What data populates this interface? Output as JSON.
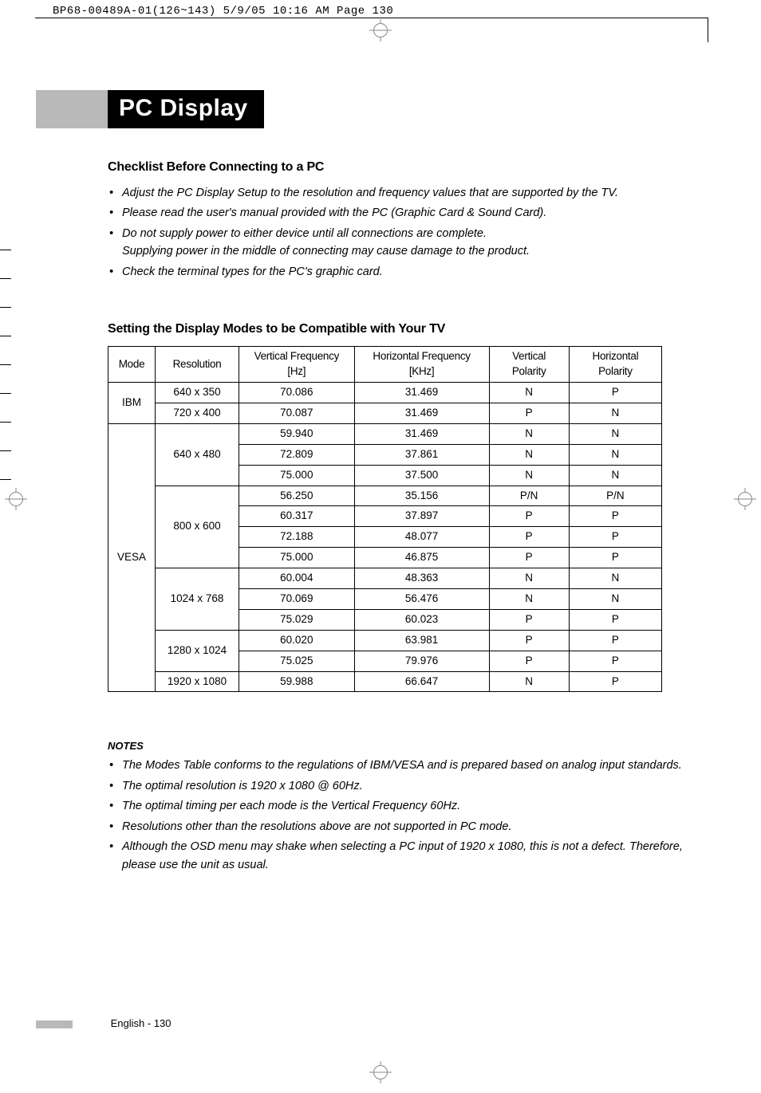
{
  "meta_line": "BP68-00489A-01(126~143)  5/9/05  10:16 AM  Page 130",
  "title": "PC Display",
  "checklist_heading": "Checklist Before Connecting to a PC",
  "checklist": [
    "Adjust the PC Display Setup to the resolution and frequency values that are supported by the TV.",
    "Please read the user's manual provided with the PC (Graphic Card & Sound Card).",
    "Do not supply power to either device until all connections are complete.\nSupplying power in the middle of connecting may cause damage to the product.",
    "Check the terminal types for the PC's graphic card."
  ],
  "modes_heading": "Setting the Display Modes to be Compatible with Your TV",
  "table": {
    "headers": [
      "Mode",
      "Resolution",
      "Vertical Frequency [Hz]",
      "Horizontal Frequency [KHz]",
      "Vertical Polarity",
      "Horizontal Polarity"
    ],
    "groups": [
      {
        "mode": "IBM",
        "res_groups": [
          {
            "res": "640 x 350",
            "rows": [
              [
                "70.086",
                "31.469",
                "N",
                "P"
              ]
            ]
          },
          {
            "res": "720 x 400",
            "rows": [
              [
                "70.087",
                "31.469",
                "P",
                "N"
              ]
            ]
          }
        ]
      },
      {
        "mode": "VESA",
        "res_groups": [
          {
            "res": "640 x 480",
            "rows": [
              [
                "59.940",
                "31.469",
                "N",
                "N"
              ],
              [
                "72.809",
                "37.861",
                "N",
                "N"
              ],
              [
                "75.000",
                "37.500",
                "N",
                "N"
              ]
            ]
          },
          {
            "res": "800 x 600",
            "rows": [
              [
                "56.250",
                "35.156",
                "P/N",
                "P/N"
              ],
              [
                "60.317",
                "37.897",
                "P",
                "P"
              ],
              [
                "72.188",
                "48.077",
                "P",
                "P"
              ],
              [
                "75.000",
                "46.875",
                "P",
                "P"
              ]
            ]
          },
          {
            "res": "1024 x 768",
            "rows": [
              [
                "60.004",
                "48.363",
                "N",
                "N"
              ],
              [
                "70.069",
                "56.476",
                "N",
                "N"
              ],
              [
                "75.029",
                "60.023",
                "P",
                "P"
              ]
            ]
          },
          {
            "res": "1280 x 1024",
            "rows": [
              [
                "60.020",
                "63.981",
                "P",
                "P"
              ],
              [
                "75.025",
                "79.976",
                "P",
                "P"
              ]
            ]
          },
          {
            "res": "1920 x 1080",
            "rows": [
              [
                "59.988",
                "66.647",
                "N",
                "P"
              ]
            ]
          }
        ]
      }
    ]
  },
  "chart_data": {
    "type": "table",
    "columns": [
      "Mode",
      "Resolution",
      "Vertical Frequency [Hz]",
      "Horizontal Frequency [KHz]",
      "Vertical Polarity",
      "Horizontal Polarity"
    ],
    "rows": [
      [
        "IBM",
        "640 x 350",
        "70.086",
        "31.469",
        "N",
        "P"
      ],
      [
        "IBM",
        "720 x 400",
        "70.087",
        "31.469",
        "P",
        "N"
      ],
      [
        "VESA",
        "640 x 480",
        "59.940",
        "31.469",
        "N",
        "N"
      ],
      [
        "VESA",
        "640 x 480",
        "72.809",
        "37.861",
        "N",
        "N"
      ],
      [
        "VESA",
        "640 x 480",
        "75.000",
        "37.500",
        "N",
        "N"
      ],
      [
        "VESA",
        "800 x 600",
        "56.250",
        "35.156",
        "P/N",
        "P/N"
      ],
      [
        "VESA",
        "800 x 600",
        "60.317",
        "37.897",
        "P",
        "P"
      ],
      [
        "VESA",
        "800 x 600",
        "72.188",
        "48.077",
        "P",
        "P"
      ],
      [
        "VESA",
        "800 x 600",
        "75.000",
        "46.875",
        "P",
        "P"
      ],
      [
        "VESA",
        "1024 x 768",
        "60.004",
        "48.363",
        "N",
        "N"
      ],
      [
        "VESA",
        "1024 x 768",
        "70.069",
        "56.476",
        "N",
        "N"
      ],
      [
        "VESA",
        "1024 x 768",
        "75.029",
        "60.023",
        "P",
        "P"
      ],
      [
        "VESA",
        "1280 x 1024",
        "60.020",
        "63.981",
        "P",
        "P"
      ],
      [
        "VESA",
        "1280 x 1024",
        "75.025",
        "79.976",
        "P",
        "P"
      ],
      [
        "VESA",
        "1920 x 1080",
        "59.988",
        "66.647",
        "N",
        "P"
      ]
    ]
  },
  "notes_heading": "NOTES",
  "notes": [
    "The Modes Table conforms to the regulations of IBM/VESA and is prepared based on analog input standards.",
    "The optimal resolution is 1920 x 1080 @ 60Hz.",
    "The optimal timing per each mode is the Vertical Frequency 60Hz.",
    "Resolutions other than the resolutions above are not supported in PC mode.",
    "Although the OSD menu may shake when selecting a PC input of 1920 x 1080, this is not a defect. Therefore, please use the unit as usual."
  ],
  "footer": "English - 130"
}
